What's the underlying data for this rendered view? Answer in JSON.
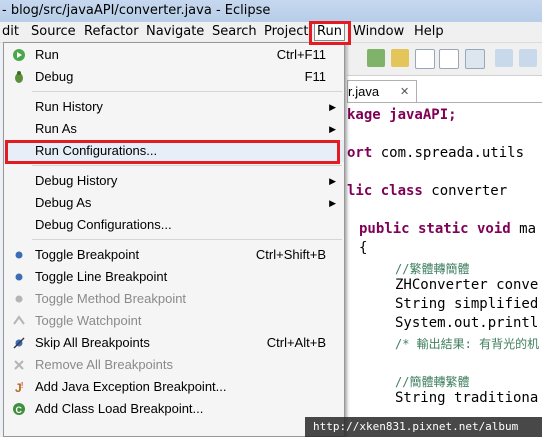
{
  "window": {
    "title": "- blog/src/javaAPI/converter.java - Eclipse"
  },
  "menubar": {
    "items": [
      "Edit",
      "Source",
      "Refactor",
      "Navigate",
      "Search",
      "Project",
      "Run",
      "Window",
      "Help"
    ],
    "first_item_visible": "dit",
    "active": "Run"
  },
  "run_menu": {
    "items": [
      {
        "label": "Run",
        "shortcut": "Ctrl+F11",
        "icon": "run-icon"
      },
      {
        "label": "Debug",
        "shortcut": "F11",
        "icon": "debug-icon"
      },
      {
        "label": "Run History",
        "submenu": true
      },
      {
        "label": "Run As",
        "submenu": true
      },
      {
        "label": "Run Configurations...",
        "highlighted": true
      },
      {
        "label": "Debug History",
        "submenu": true
      },
      {
        "label": "Debug As",
        "submenu": true
      },
      {
        "label": "Debug Configurations..."
      },
      {
        "label": "Toggle Breakpoint",
        "shortcut": "Ctrl+Shift+B",
        "icon": "breakpoint-icon"
      },
      {
        "label": "Toggle Line Breakpoint",
        "icon": "breakpoint-icon"
      },
      {
        "label": "Toggle Method Breakpoint",
        "disabled": true,
        "icon": "breakpoint-icon"
      },
      {
        "label": "Toggle Watchpoint",
        "disabled": true,
        "icon": "watchpoint-icon"
      },
      {
        "label": "Skip All Breakpoints",
        "shortcut": "Ctrl+Alt+B",
        "icon": "skip-breakpoints-icon"
      },
      {
        "label": "Remove All Breakpoints",
        "disabled": true,
        "icon": "remove-breakpoints-icon"
      },
      {
        "label": "Add Java Exception Breakpoint...",
        "icon": "java-exception-icon"
      },
      {
        "label": "Add Class Load Breakpoint...",
        "icon": "class-load-icon"
      }
    ]
  },
  "editor": {
    "tab_label": "r.java",
    "code_lines": [
      {
        "text": "kage javaAPI;",
        "kw": ""
      },
      {
        "kw": "ort",
        "text": " com.spreada.utils"
      },
      {
        "kw": "lic class",
        "text": " converter"
      },
      {
        "kw": "public static void",
        "text": " ma"
      },
      {
        "text": "{"
      },
      {
        "cm": "//繁體轉簡體"
      },
      {
        "text": "ZHConverter conve"
      },
      {
        "text": "String simplified"
      },
      {
        "text": "System.out.printl"
      },
      {
        "cm": "/* 輸出結果: 有背光的机"
      },
      {
        "cm": "//簡體轉繁體"
      },
      {
        "text": "String traditiona"
      }
    ]
  },
  "watermark": {
    "text": "http://xken831.pixnet.net/album"
  },
  "colors": {
    "highlight_box": "#e31b23",
    "keyword": "#7f0055",
    "comment": "#3f7f5f"
  }
}
